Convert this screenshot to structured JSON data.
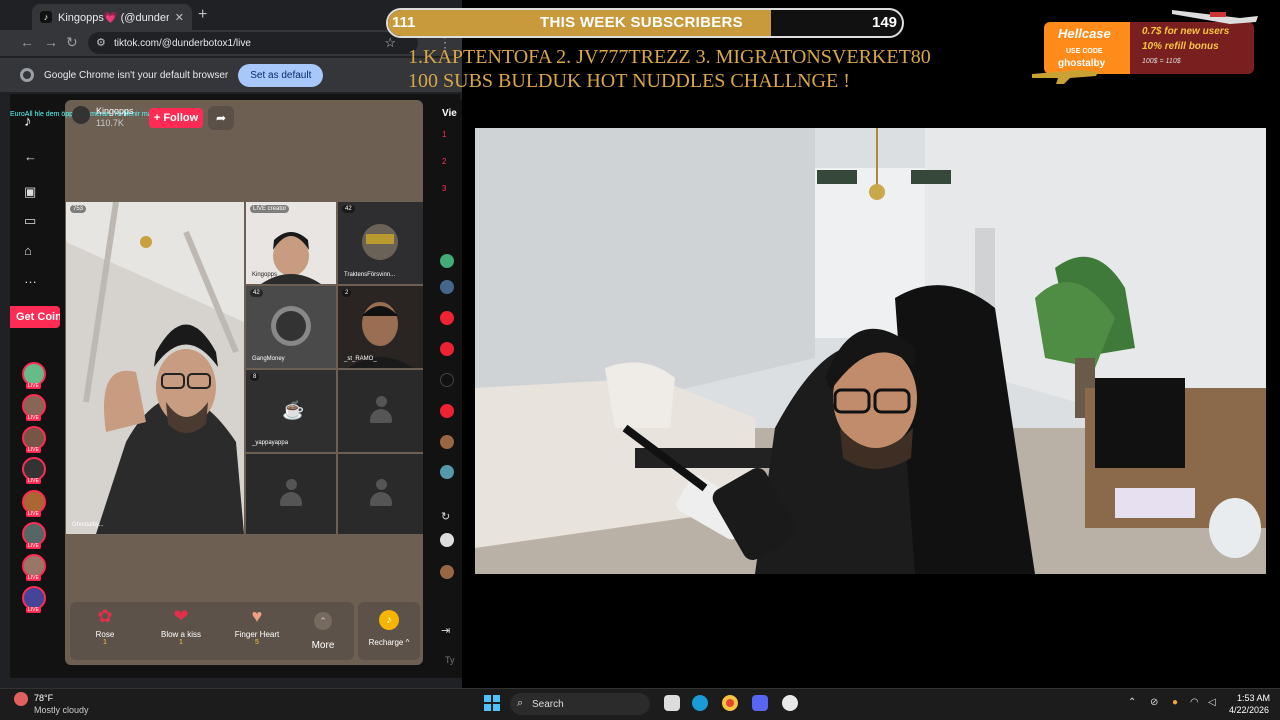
{
  "browser": {
    "tab_title": "Kingopps💗 (@dunderbot",
    "tab_favicon": "tiktok-icon",
    "url": "tiktok.com/@dunderbotox1/live",
    "infobar_text": "Google Chrome isn't your default browser",
    "set_default_label": "Set as default"
  },
  "tiktok": {
    "get_coins": "Get Coins",
    "host_name": "Kingopps",
    "host_likes": "110.7K",
    "follow_label": "+ Follow",
    "ticker_text": "EuroAll hle dem öppna kameran 'Yerlilenir main",
    "host_tile_label": "Ghostalby...",
    "host_tile_count": "753",
    "guests": [
      {
        "label": "Kingopps",
        "badge": "LIVE creator"
      },
      {
        "label": "TraktensFörsvinn...",
        "count": "42"
      },
      {
        "label": "GangMoney",
        "count": "42"
      },
      {
        "label": "_st_RAMO_",
        "count": "2"
      },
      {
        "label": "_yappayappa",
        "count": "8"
      }
    ],
    "gifts": [
      {
        "name": "Rose",
        "price": "1",
        "icon": "rose-icon"
      },
      {
        "name": "Blow a kiss",
        "price": "1",
        "icon": "kiss-icon"
      },
      {
        "name": "Finger Heart",
        "price": "5",
        "icon": "finger-heart-icon"
      }
    ],
    "more_label": "More",
    "recharge_label": "Recharge ^",
    "right_strip_header": "Vie",
    "right_strip_ranks": [
      "1",
      "2",
      "3"
    ],
    "comment_placeholder": "Ty"
  },
  "overlay": {
    "sub_current": "111",
    "sub_title": "THIS WEEK SUBSCRIBERS",
    "sub_goal": "149",
    "sub_progress": 0.745,
    "top_subs": "1.KAPTENTOFA    2. JV777TREZZ   3.  MIGRATONSVERKET80",
    "challenge": "100 SUBS BULDUK HOT NUDDLES CHALLNGE !",
    "hellcase": {
      "logo": "Hellcase",
      "use_code_label": "USE CODE",
      "code": "ghostalby",
      "line1": "0.7$ for new users",
      "line2": "10% refill bonus",
      "line3": "100$ = 110$"
    }
  },
  "taskbar": {
    "temp": "78°F",
    "weather": "Mostly cloudy",
    "search_label": "Search",
    "time": "1:53 AM",
    "date": "4/22/2026"
  },
  "colors": {
    "tiktok_red": "#fe2c55",
    "overlay_gold": "#d9a64a",
    "hellcase_orange": "#ff8c1a"
  }
}
